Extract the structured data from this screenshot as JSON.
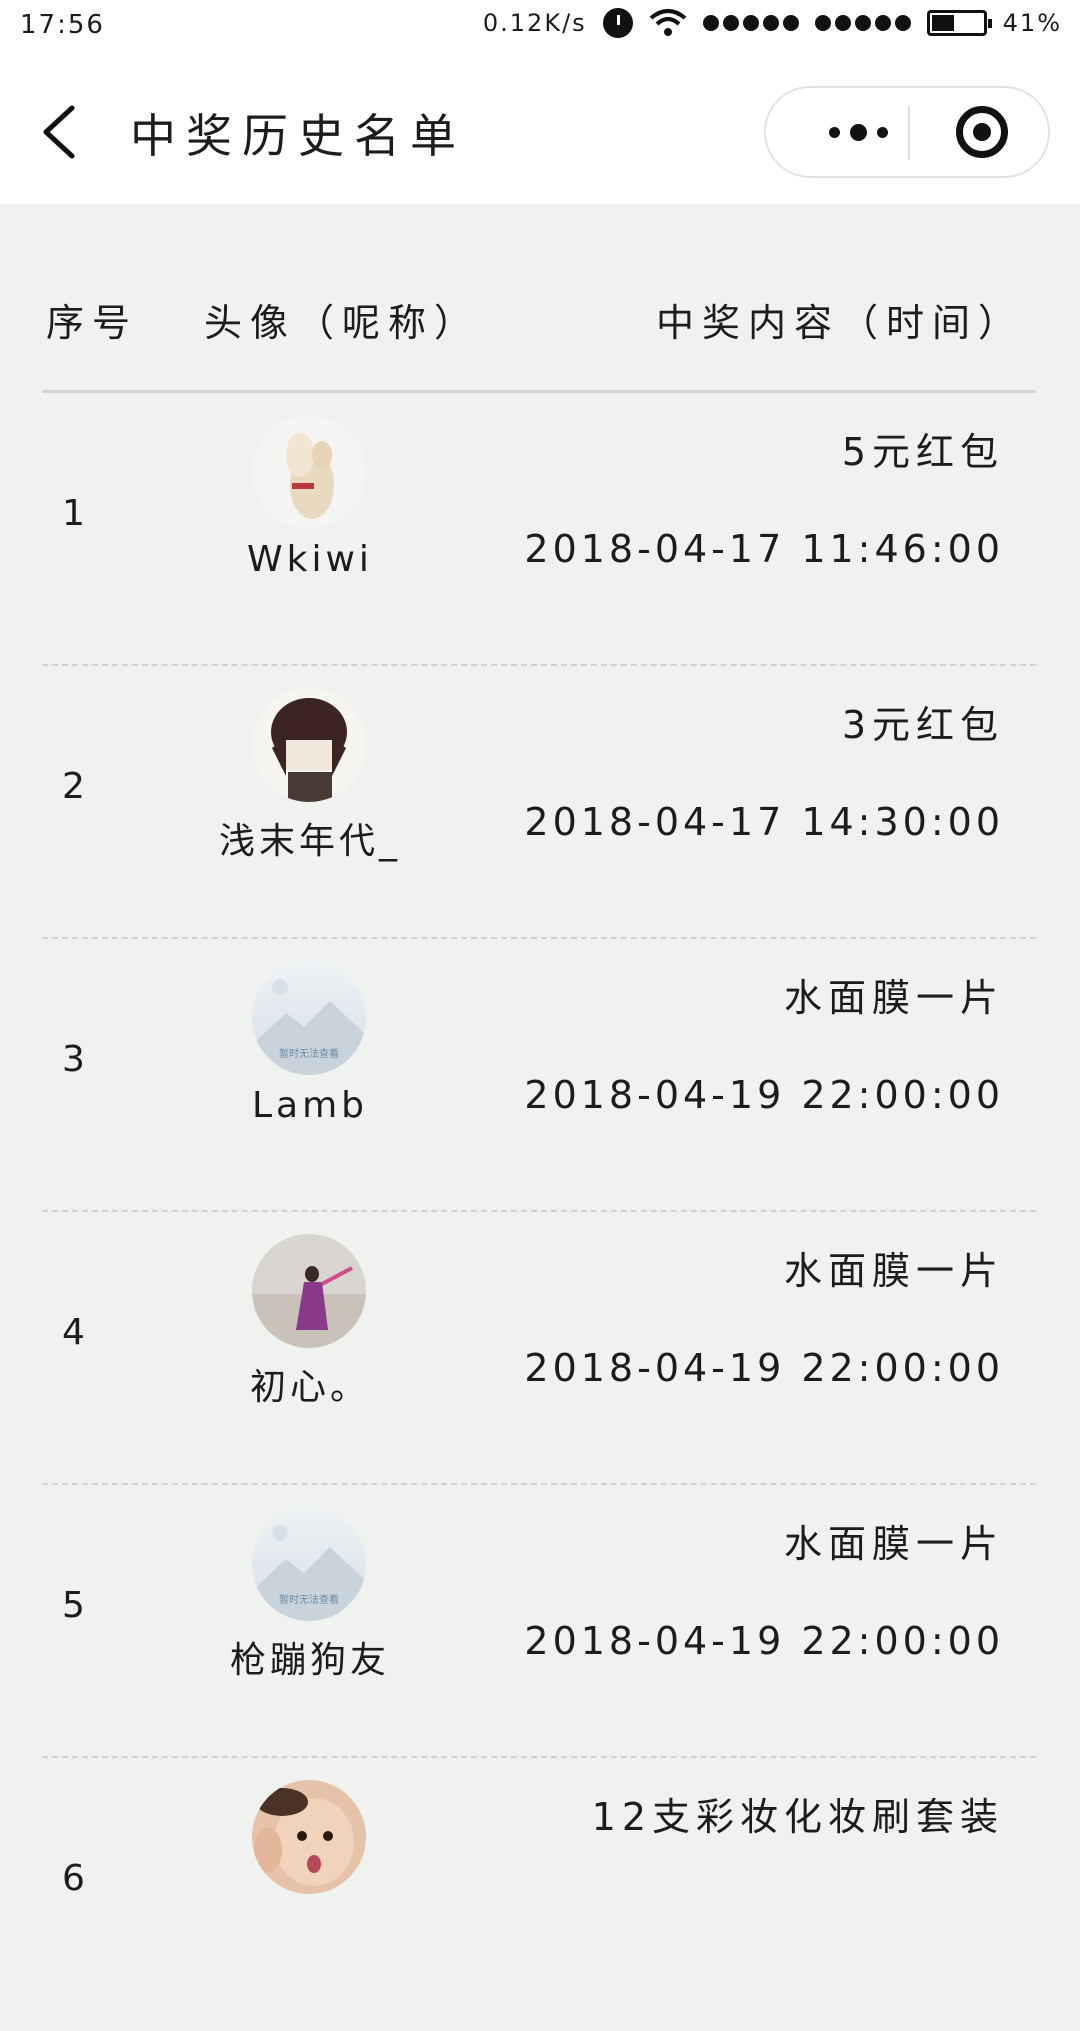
{
  "status_bar": {
    "time": "17:56",
    "net_speed": "0.12K/s",
    "battery": "41%",
    "battery_level": 0.41
  },
  "nav": {
    "title": "中奖历史名单"
  },
  "table": {
    "headers": {
      "seq": "序号",
      "avatar": "头像（呢称）",
      "prize": "中奖内容（时间）"
    },
    "rows": [
      {
        "seq": "1",
        "nick": "Wkiwi",
        "prize": "5元红包",
        "time": "2018-04-17 11:46:00"
      },
      {
        "seq": "2",
        "nick": "浅末年代_",
        "prize": "3元红包",
        "time": "2018-04-17 14:30:00"
      },
      {
        "seq": "3",
        "nick": "Lamb",
        "prize": "水面膜一片",
        "time": "2018-04-19 22:00:00"
      },
      {
        "seq": "4",
        "nick": "初心。",
        "prize": "水面膜一片",
        "time": "2018-04-19 22:00:00"
      },
      {
        "seq": "5",
        "nick": "枪蹦狗友",
        "prize": "水面膜一片",
        "time": "2018-04-19 22:00:00"
      },
      {
        "seq": "6",
        "nick": "",
        "prize": "12支彩妆化妆刷套装",
        "time": ""
      }
    ],
    "placeholder_avatar_text": "暂时无法查看"
  },
  "colors": {
    "background": "#f0f2ef",
    "bar": "#ffffff",
    "text": "#1c1c1c"
  }
}
